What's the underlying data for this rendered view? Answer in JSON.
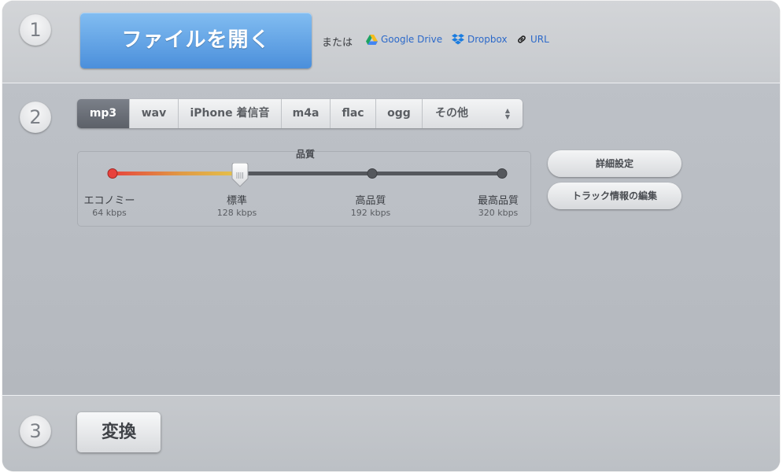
{
  "steps": {
    "one": "1",
    "two": "2",
    "three": "3"
  },
  "open": {
    "button_label": "ファイルを開く",
    "or_text": "または",
    "links": [
      {
        "label": "Google Drive",
        "icon": "google-drive-icon"
      },
      {
        "label": "Dropbox",
        "icon": "dropbox-icon"
      },
      {
        "label": "URL",
        "icon": "link-icon"
      }
    ]
  },
  "formats": {
    "tabs": [
      "mp3",
      "wav",
      "iPhone 着信音",
      "m4a",
      "flac",
      "ogg",
      "その他"
    ],
    "selected": "mp3"
  },
  "quality": {
    "title": "品質",
    "selected_index": 1,
    "levels": [
      {
        "label": "エコノミー",
        "bitrate": "64 kbps"
      },
      {
        "label": "標準",
        "bitrate": "128 kbps"
      },
      {
        "label": "高品質",
        "bitrate": "192 kbps"
      },
      {
        "label": "最高品質",
        "bitrate": "320 kbps"
      }
    ]
  },
  "options": {
    "advanced_label": "詳細設定",
    "track_info_label": "トラック情報の編集"
  },
  "convert": {
    "button_label": "変換"
  },
  "colors": {
    "primary_blue": "#4b8fdb",
    "link_blue": "#2c69c9",
    "slider_start": "#e8413c",
    "slider_mid": "#e5c34a"
  }
}
